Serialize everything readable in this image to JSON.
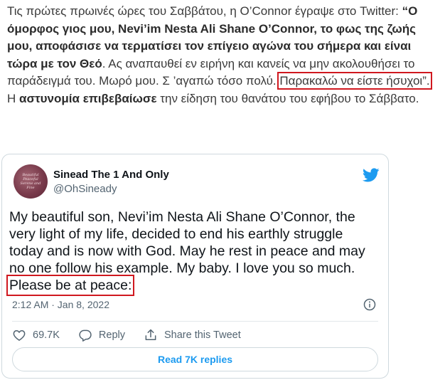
{
  "article": {
    "p1": "Τις πρώτες πρωινές ώρες του Σαββάτου, η O’Connor έγραψε στο Twitter: ",
    "quote_bold": "“Ο όμορφος γιος μου, Nevi’im Nesta Ali Shane O’Connor, το φως της ζωής μου, αποφάσισε να τερματίσει τον επίγειο αγώνα του σήμερα και είναι τώρα με τον Θεό",
    "p2": ". Ας αναπαυθεί εν ειρήνη και κανείς να μην ακολουθήσει το παράδειγμά του. Μωρό μου. Σ ’αγαπώ τόσο πολύ. ",
    "highlight": "Παρακαλώ να είστε ήσυχοι”.",
    "p3": " Η ",
    "police_bold": "αστυνομία επιβεβαίωσε",
    "p4": " την είδηση του θανάτου του εφήβου το Σάββατο."
  },
  "tweet": {
    "name": "Sinead The 1 And Only",
    "handle": "@OhSineady",
    "avatar_text": "Beautiful Peaceful Serene and Fine",
    "lines": [
      "My beautiful son, Nevi’im Nesta Ali Shane O’Connor, the",
      "very light of my life, decided to end his earthly struggle",
      "today and is now with God. May he rest in peace and may",
      "no one follow his example.  My baby. I love you so much."
    ],
    "highlight_line": "Please be at peace:",
    "timestamp": "2:12 AM · Jan 8, 2022",
    "likes": "69.7K",
    "reply_label": "Reply",
    "share_label": "Share this Tweet",
    "read_replies": "Read 7K replies"
  },
  "colors": {
    "highlight_border": "#d0181f",
    "twitter_blue": "#1d9bf0",
    "muted": "#536471"
  }
}
